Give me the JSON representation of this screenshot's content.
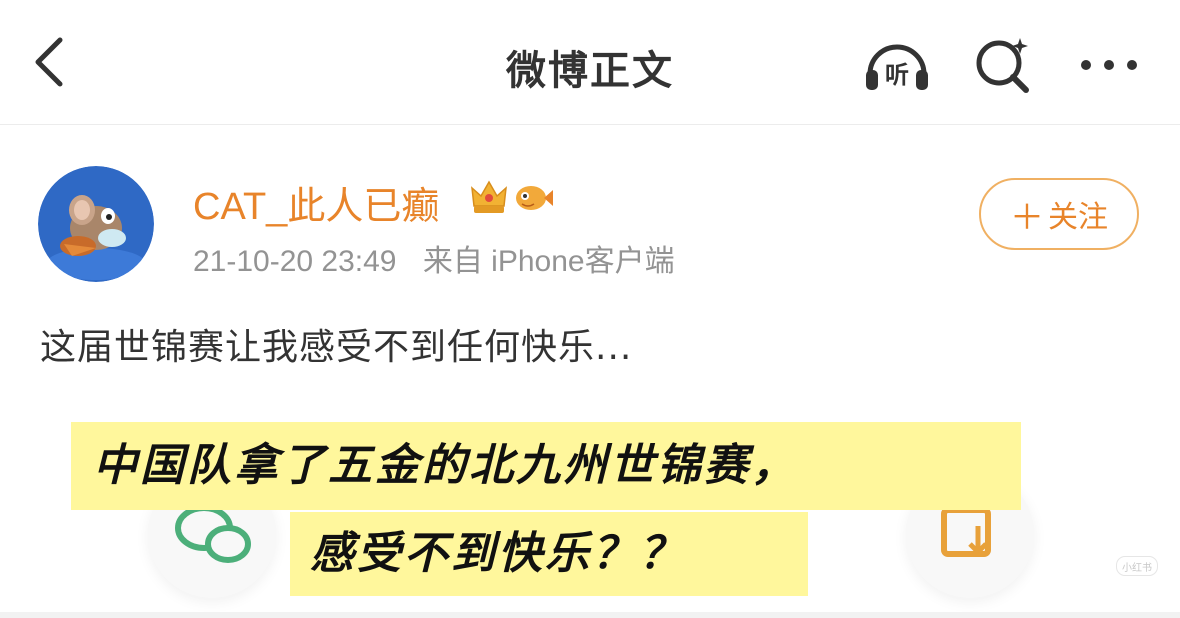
{
  "header": {
    "title": "微博正文",
    "listen_label": "听",
    "icons": {
      "back": "chevron-left-icon",
      "listen": "headphones-icon",
      "search": "search-sparkle-icon",
      "more": "more-dots-icon"
    }
  },
  "post": {
    "author": "CAT_此人已癫",
    "badges": [
      "crown-badge-icon",
      "fish-badge-icon"
    ],
    "timestamp": "21-10-20 23:49",
    "source": "来自 iPhone客户端",
    "follow_label": "关注",
    "text": "这届世锦赛让我感受不到任何快乐..."
  },
  "caption": {
    "line1": "中国队拿了五金的北九州世锦赛，",
    "line2": "感受不到快乐？？"
  },
  "watermark": "小红书",
  "colors": {
    "accent": "#e8842a",
    "caption_bg": "#fff79c",
    "avatar_bg": "#2f69c5"
  }
}
